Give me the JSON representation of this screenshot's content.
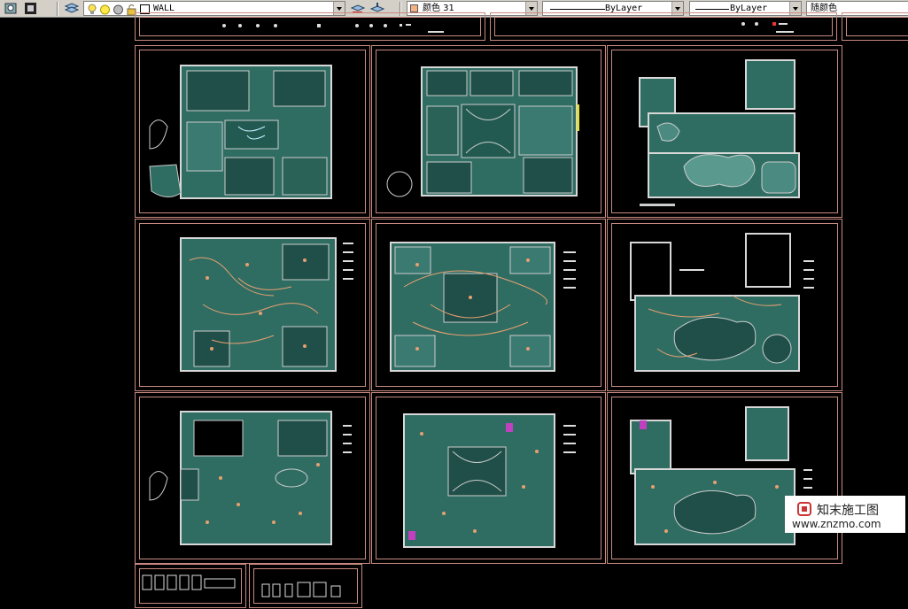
{
  "toolbar": {
    "layer_name": "WALL",
    "color_label": "颜色 31",
    "linetype_label": "ByLayer",
    "lineweight_label": "ByLayer",
    "plotstyle_label": "随颜色",
    "color_swatch": "#f4b183"
  },
  "drawing": {
    "sheet_count": 9,
    "rows": [
      "floor-plans",
      "electrical-plans",
      "lighting-layouts"
    ]
  },
  "watermark": {
    "name": "知末施工图",
    "url": "www.znzmo.com"
  },
  "colors": {
    "frame": "#c88a80",
    "wall": "#d8d8d8",
    "fill": "#2f6d63",
    "electric": "#e8a070"
  }
}
